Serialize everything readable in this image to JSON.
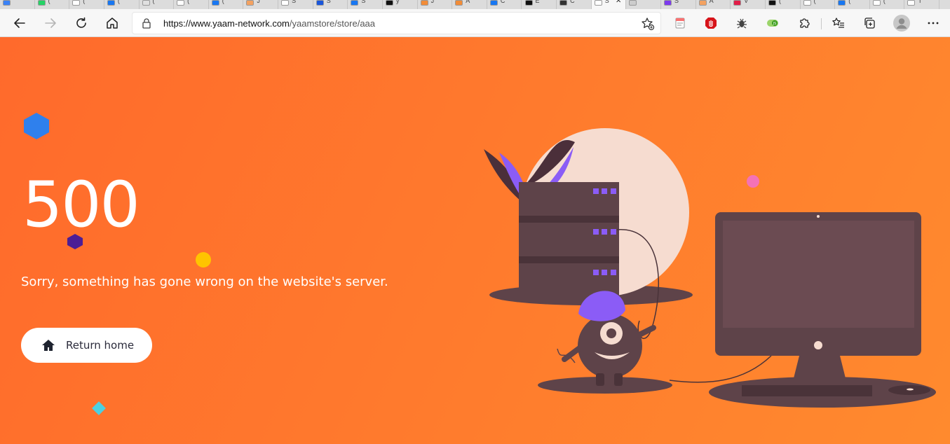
{
  "browser": {
    "tabs": [
      {
        "fav": "#3b82f6",
        "text": ""
      },
      {
        "fav": "#25d366",
        "text": "("
      },
      {
        "fav": "#ffffff",
        "text": "("
      },
      {
        "fav": "#1877f2",
        "text": "("
      },
      {
        "fav": "#e0e0e0",
        "text": "("
      },
      {
        "fav": "#ffffff",
        "text": "("
      },
      {
        "fav": "#1877f2",
        "text": "("
      },
      {
        "fav": "#f4a261",
        "text": "J"
      },
      {
        "fav": "#ffffff",
        "text": "S"
      },
      {
        "fav": "#1a56db",
        "text": "S"
      },
      {
        "fav": "#1877f2",
        "text": "S"
      },
      {
        "fav": "#111111",
        "text": "y"
      },
      {
        "fav": "#f28c38",
        "text": "J"
      },
      {
        "fav": "#f28c38",
        "text": "A"
      },
      {
        "fav": "#1877f2",
        "text": "C"
      },
      {
        "fav": "#111111",
        "text": "E"
      },
      {
        "fav": "#333333",
        "text": "C"
      },
      {
        "fav": "#ffffff",
        "text": "S",
        "active": true
      },
      {
        "fav": "#cccccc",
        "text": ""
      },
      {
        "fav": "#7c3aed",
        "text": "S"
      },
      {
        "fav": "#f4a261",
        "text": "A"
      },
      {
        "fav": "#e11d48",
        "text": "V"
      },
      {
        "fav": "#111111",
        "text": "("
      },
      {
        "fav": "#ffffff",
        "text": "("
      },
      {
        "fav": "#1877f2",
        "text": "("
      },
      {
        "fav": "#ffffff",
        "text": "("
      },
      {
        "fav": "#ffffff",
        "text": "T"
      }
    ],
    "url_host": "https://www.yaam-network.com",
    "url_path": "/yaamstore/store/aaa"
  },
  "page": {
    "error_code": "500",
    "message": "Sorry, something has gone wrong on the website's server.",
    "button_label": "Return home",
    "background_start": "#ff6a2c",
    "background_end": "#ff8a2e"
  }
}
